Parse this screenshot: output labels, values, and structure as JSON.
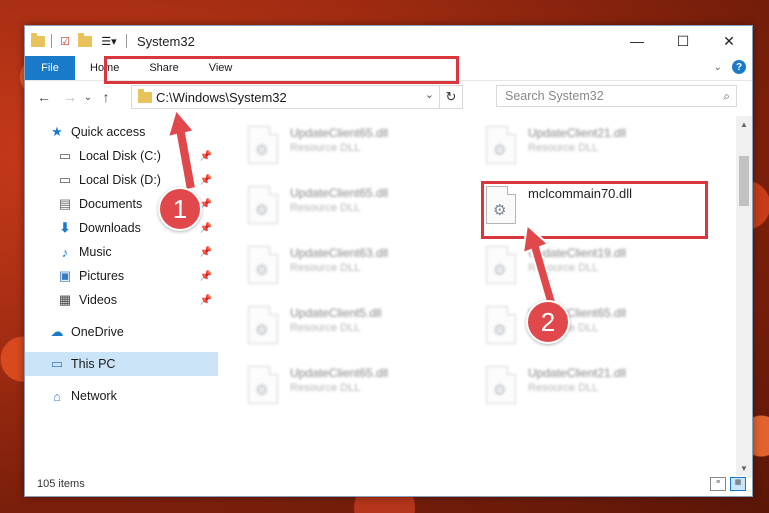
{
  "window": {
    "title": "System32",
    "controls": {
      "minimize": "—",
      "maximize": "☐",
      "close": "✕"
    }
  },
  "ribbon": {
    "tabs": [
      {
        "label": "File",
        "active": true
      },
      {
        "label": "Home"
      },
      {
        "label": "Share"
      },
      {
        "label": "View"
      }
    ]
  },
  "nav": {
    "address": "C:\\Windows\\System32",
    "search_placeholder": "Search System32"
  },
  "sidebar": {
    "items": [
      {
        "label": "Quick access",
        "icon": "star-icon"
      },
      {
        "label": "Local Disk (C:)",
        "icon": "drive-icon",
        "pinned": true
      },
      {
        "label": "Local Disk (D:)",
        "icon": "drive-icon",
        "pinned": true
      },
      {
        "label": "Documents",
        "icon": "documents-icon",
        "pinned": true
      },
      {
        "label": "Downloads",
        "icon": "downloads-icon",
        "pinned": true
      },
      {
        "label": "Music",
        "icon": "music-icon",
        "pinned": true
      },
      {
        "label": "Pictures",
        "icon": "pictures-icon",
        "pinned": true
      },
      {
        "label": "Videos",
        "icon": "videos-icon",
        "pinned": true
      },
      {
        "label": "OneDrive",
        "icon": "cloud-icon"
      },
      {
        "label": "This PC",
        "icon": "computer-icon",
        "selected": true
      },
      {
        "label": "Network",
        "icon": "network-icon"
      }
    ]
  },
  "files": {
    "left": [
      {
        "name": "UpdateClient65.dll",
        "type": "Resource DLL"
      },
      {
        "name": "UpdateClient65.dll",
        "type": "Resource DLL"
      },
      {
        "name": "UpdateClient63.dll",
        "type": "Resource DLL"
      },
      {
        "name": "UpdateClient5.dll",
        "type": "Resource DLL"
      },
      {
        "name": "UpdateClient65.dll",
        "type": "Resource DLL"
      }
    ],
    "right": [
      {
        "name": "UpdateClient21.dll",
        "type": "Resource DLL"
      },
      {
        "name": "mclcommain70.dll",
        "type": "",
        "highlighted": true
      },
      {
        "name": "UpdateClient19.dll",
        "type": "Resource DLL"
      },
      {
        "name": "UpdateClient65.dll",
        "type": "Resource DLL"
      },
      {
        "name": "UpdateClient21.dll",
        "type": "Resource DLL"
      }
    ]
  },
  "status": {
    "item_count": "105 items"
  },
  "callouts": {
    "one": "1",
    "two": "2"
  },
  "colors": {
    "accent": "#1979ca",
    "highlight": "#d9363e",
    "callout": "#e0484c"
  }
}
